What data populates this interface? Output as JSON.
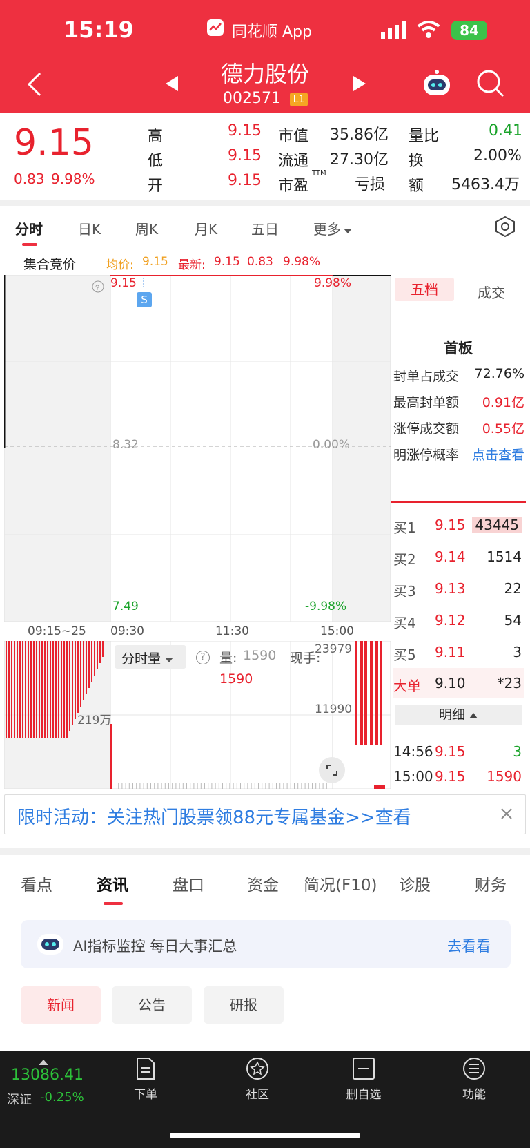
{
  "status": {
    "time": "15:19",
    "app_name": "同花顺 App",
    "battery": "84"
  },
  "header": {
    "stock_name": "德力股份",
    "code": "002571",
    "level": "L1"
  },
  "quote": {
    "price": "9.15",
    "change": "0.83",
    "pct": "9.98%",
    "high_label": "高",
    "high": "9.15",
    "low_label": "低",
    "low": "9.15",
    "open_label": "开",
    "open": "9.15",
    "mcap_label": "市值",
    "mcap": "35.86亿",
    "float_label": "流通",
    "float": "27.30亿",
    "pe_label": "市盈",
    "pe_sup": "TTM",
    "pe": "亏损",
    "vr_label": "量比",
    "vr": "0.41",
    "turn_label": "换",
    "turn": "2.00%",
    "amt_label": "额",
    "amt": "5463.4万"
  },
  "chart_tabs": [
    "分时",
    "日K",
    "周K",
    "月K",
    "五日",
    "更多"
  ],
  "chart_info": {
    "auction_label": "集合竞价",
    "avg_label": "均价:",
    "avg": "9.15",
    "latest_label": "最新:",
    "latest": "9.15",
    "chg": "0.83",
    "pct": "9.98%"
  },
  "chart_data": {
    "type": "line",
    "title": "",
    "price_axis": {
      "top": "9.15",
      "mid": "8.32",
      "bottom": "7.49",
      "top_pct": "9.98%",
      "mid_pct": "0.00%",
      "bottom_pct": "-9.98%"
    },
    "x_ticks": [
      "09:15~25",
      "09:30",
      "11:30",
      "15:00"
    ],
    "price_series": {
      "x": [
        "09:15",
        "15:00"
      ],
      "y": [
        9.15,
        9.15
      ]
    },
    "marker": "S",
    "volume_panel": {
      "label": "分时量",
      "vol_label": "量:",
      "vol": "1590",
      "hand_label": "现手:",
      "hand": "1590",
      "ytick_top": "23979",
      "ytick_mid": "11990",
      "auction_tick": "219万"
    }
  },
  "side": {
    "tab_five": "五档",
    "tab_deal": "成交",
    "board": "首板",
    "metrics": [
      {
        "label": "封单占成交",
        "value": "72.76%"
      },
      {
        "label": "最高封单额",
        "value": "0.91亿"
      },
      {
        "label": "涨停成交额",
        "value": "0.55亿"
      },
      {
        "label": "明涨停概率",
        "value": "点击查看"
      }
    ],
    "bids": [
      {
        "label": "买1",
        "price": "9.15",
        "vol": "43445"
      },
      {
        "label": "买2",
        "price": "9.14",
        "vol": "1514"
      },
      {
        "label": "买3",
        "price": "9.13",
        "vol": "22"
      },
      {
        "label": "买4",
        "price": "9.12",
        "vol": "54"
      },
      {
        "label": "买5",
        "price": "9.11",
        "vol": "3"
      }
    ],
    "big": {
      "label": "大单",
      "price": "9.10",
      "vol": "*23"
    },
    "detail_label": "明细",
    "ticks": [
      {
        "time": "14:56",
        "price": "9.15",
        "vol": "3"
      },
      {
        "time": "15:00",
        "price": "9.15",
        "vol": "1590"
      }
    ]
  },
  "banner": {
    "text": "限时活动：关注热门股票领88元专属基金>>查看"
  },
  "news_tabs": [
    "看点",
    "资讯",
    "盘口",
    "资金",
    "简况(F10)",
    "诊股",
    "财务"
  ],
  "ai": {
    "text": "AI指标监控 每日大事汇总",
    "link": "去看看"
  },
  "sub_tabs": [
    "新闻",
    "公告",
    "研报"
  ],
  "bottom": {
    "index_value": "13086.41",
    "index_name": "深证",
    "index_pct": "-0.25%",
    "items": [
      "下单",
      "社区",
      "删自选",
      "功能"
    ]
  },
  "colors": {
    "brand": "#ee3040",
    "up": "#e8222e",
    "down": "#1aa32a",
    "link": "#2f7de1"
  }
}
